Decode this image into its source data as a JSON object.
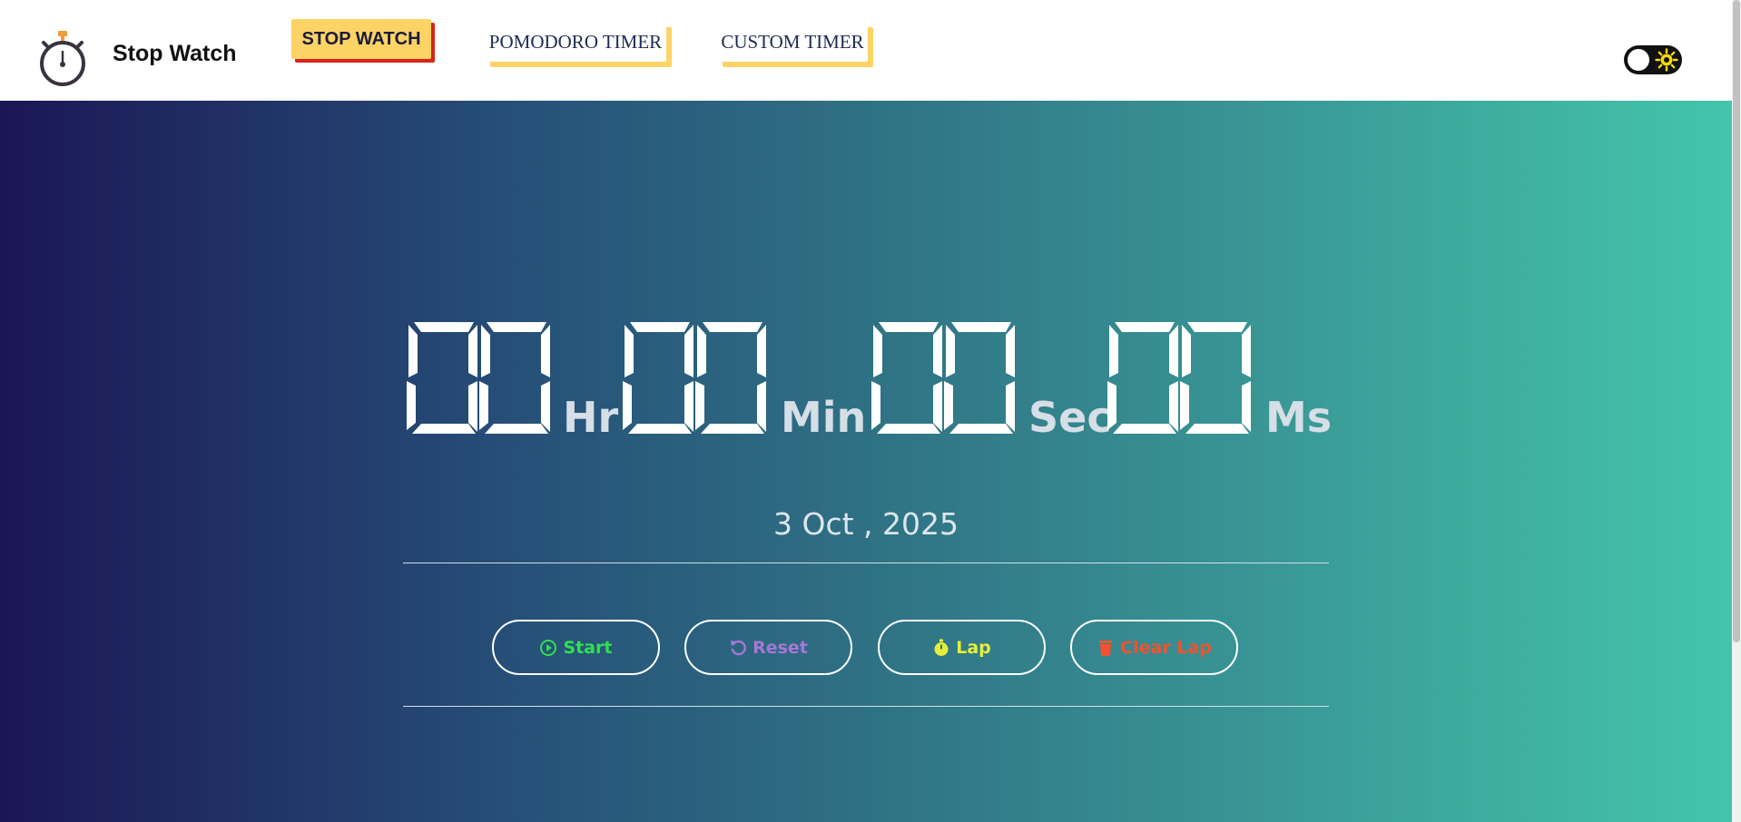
{
  "brand": {
    "title": "Stop Watch",
    "logo_icon": "stopwatch-icon"
  },
  "nav": {
    "items": [
      {
        "label": "STOP WATCH",
        "active": true
      },
      {
        "label": "POMODORO TIMER",
        "active": false
      },
      {
        "label": "CUSTOM TIMER",
        "active": false
      }
    ]
  },
  "theme_toggle": {
    "state": "light",
    "icon": "sun-icon"
  },
  "timer": {
    "hours": "00",
    "hours_unit": "Hr",
    "minutes": "00",
    "minutes_unit": "Min",
    "seconds": "00",
    "seconds_unit": "Sec",
    "milliseconds": "00",
    "milliseconds_unit": "Ms"
  },
  "date": "3 Oct , 2025",
  "controls": {
    "start": {
      "label": "Start",
      "icon": "play-circle-icon",
      "color": "#2fe04f"
    },
    "reset": {
      "label": "Reset",
      "icon": "undo-icon",
      "color": "#a777d6"
    },
    "lap": {
      "label": "Lap",
      "icon": "stopwatch-icon",
      "color": "#e6ee3d"
    },
    "clear_lap": {
      "label": "Clear Lap",
      "icon": "trash-icon",
      "color": "#f0522f"
    }
  },
  "colors": {
    "accent_yellow": "#fdd365",
    "accent_red": "#d8241d",
    "gradient_start": "#1b1656",
    "gradient_end": "#43c5ab"
  }
}
